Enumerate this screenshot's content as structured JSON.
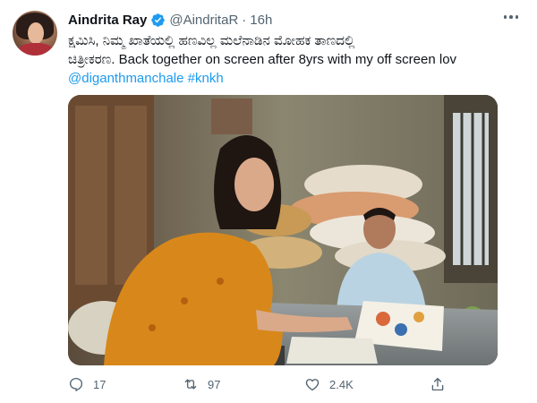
{
  "tweet": {
    "author_name": "Aindrita Ray",
    "handle": "@AindritaR",
    "separator": "·",
    "timestamp": "16h",
    "verified": true,
    "text_lines": [
      "ಕ್ಷಮಿಸಿ, ನಿಮ್ಮ ಖಾತೆಯಲ್ಲಿ ಹಣವಿಲ್ಲ ಮಲೆನಾಡಿನ ಮೋಹಕ ತಾಣದಲ್ಲಿ",
      "ಚಿತ್ರೀಕರಣ. Back together on screen after 8yrs with my off screen lov"
    ],
    "mentions": [
      "@diganthmanchale",
      "#knkh"
    ],
    "link_color": "#1d9bf0"
  },
  "actions": {
    "reply": {
      "icon": "reply-icon",
      "count": "17"
    },
    "retweet": {
      "icon": "retweet-icon",
      "count": "97"
    },
    "like": {
      "icon": "heart-icon",
      "count": "2.4K"
    },
    "share": {
      "icon": "share-icon"
    }
  },
  "colors": {
    "verified_badge": "#1d9bf0",
    "secondary_text": "#536471",
    "primary_text": "#0f1419"
  }
}
